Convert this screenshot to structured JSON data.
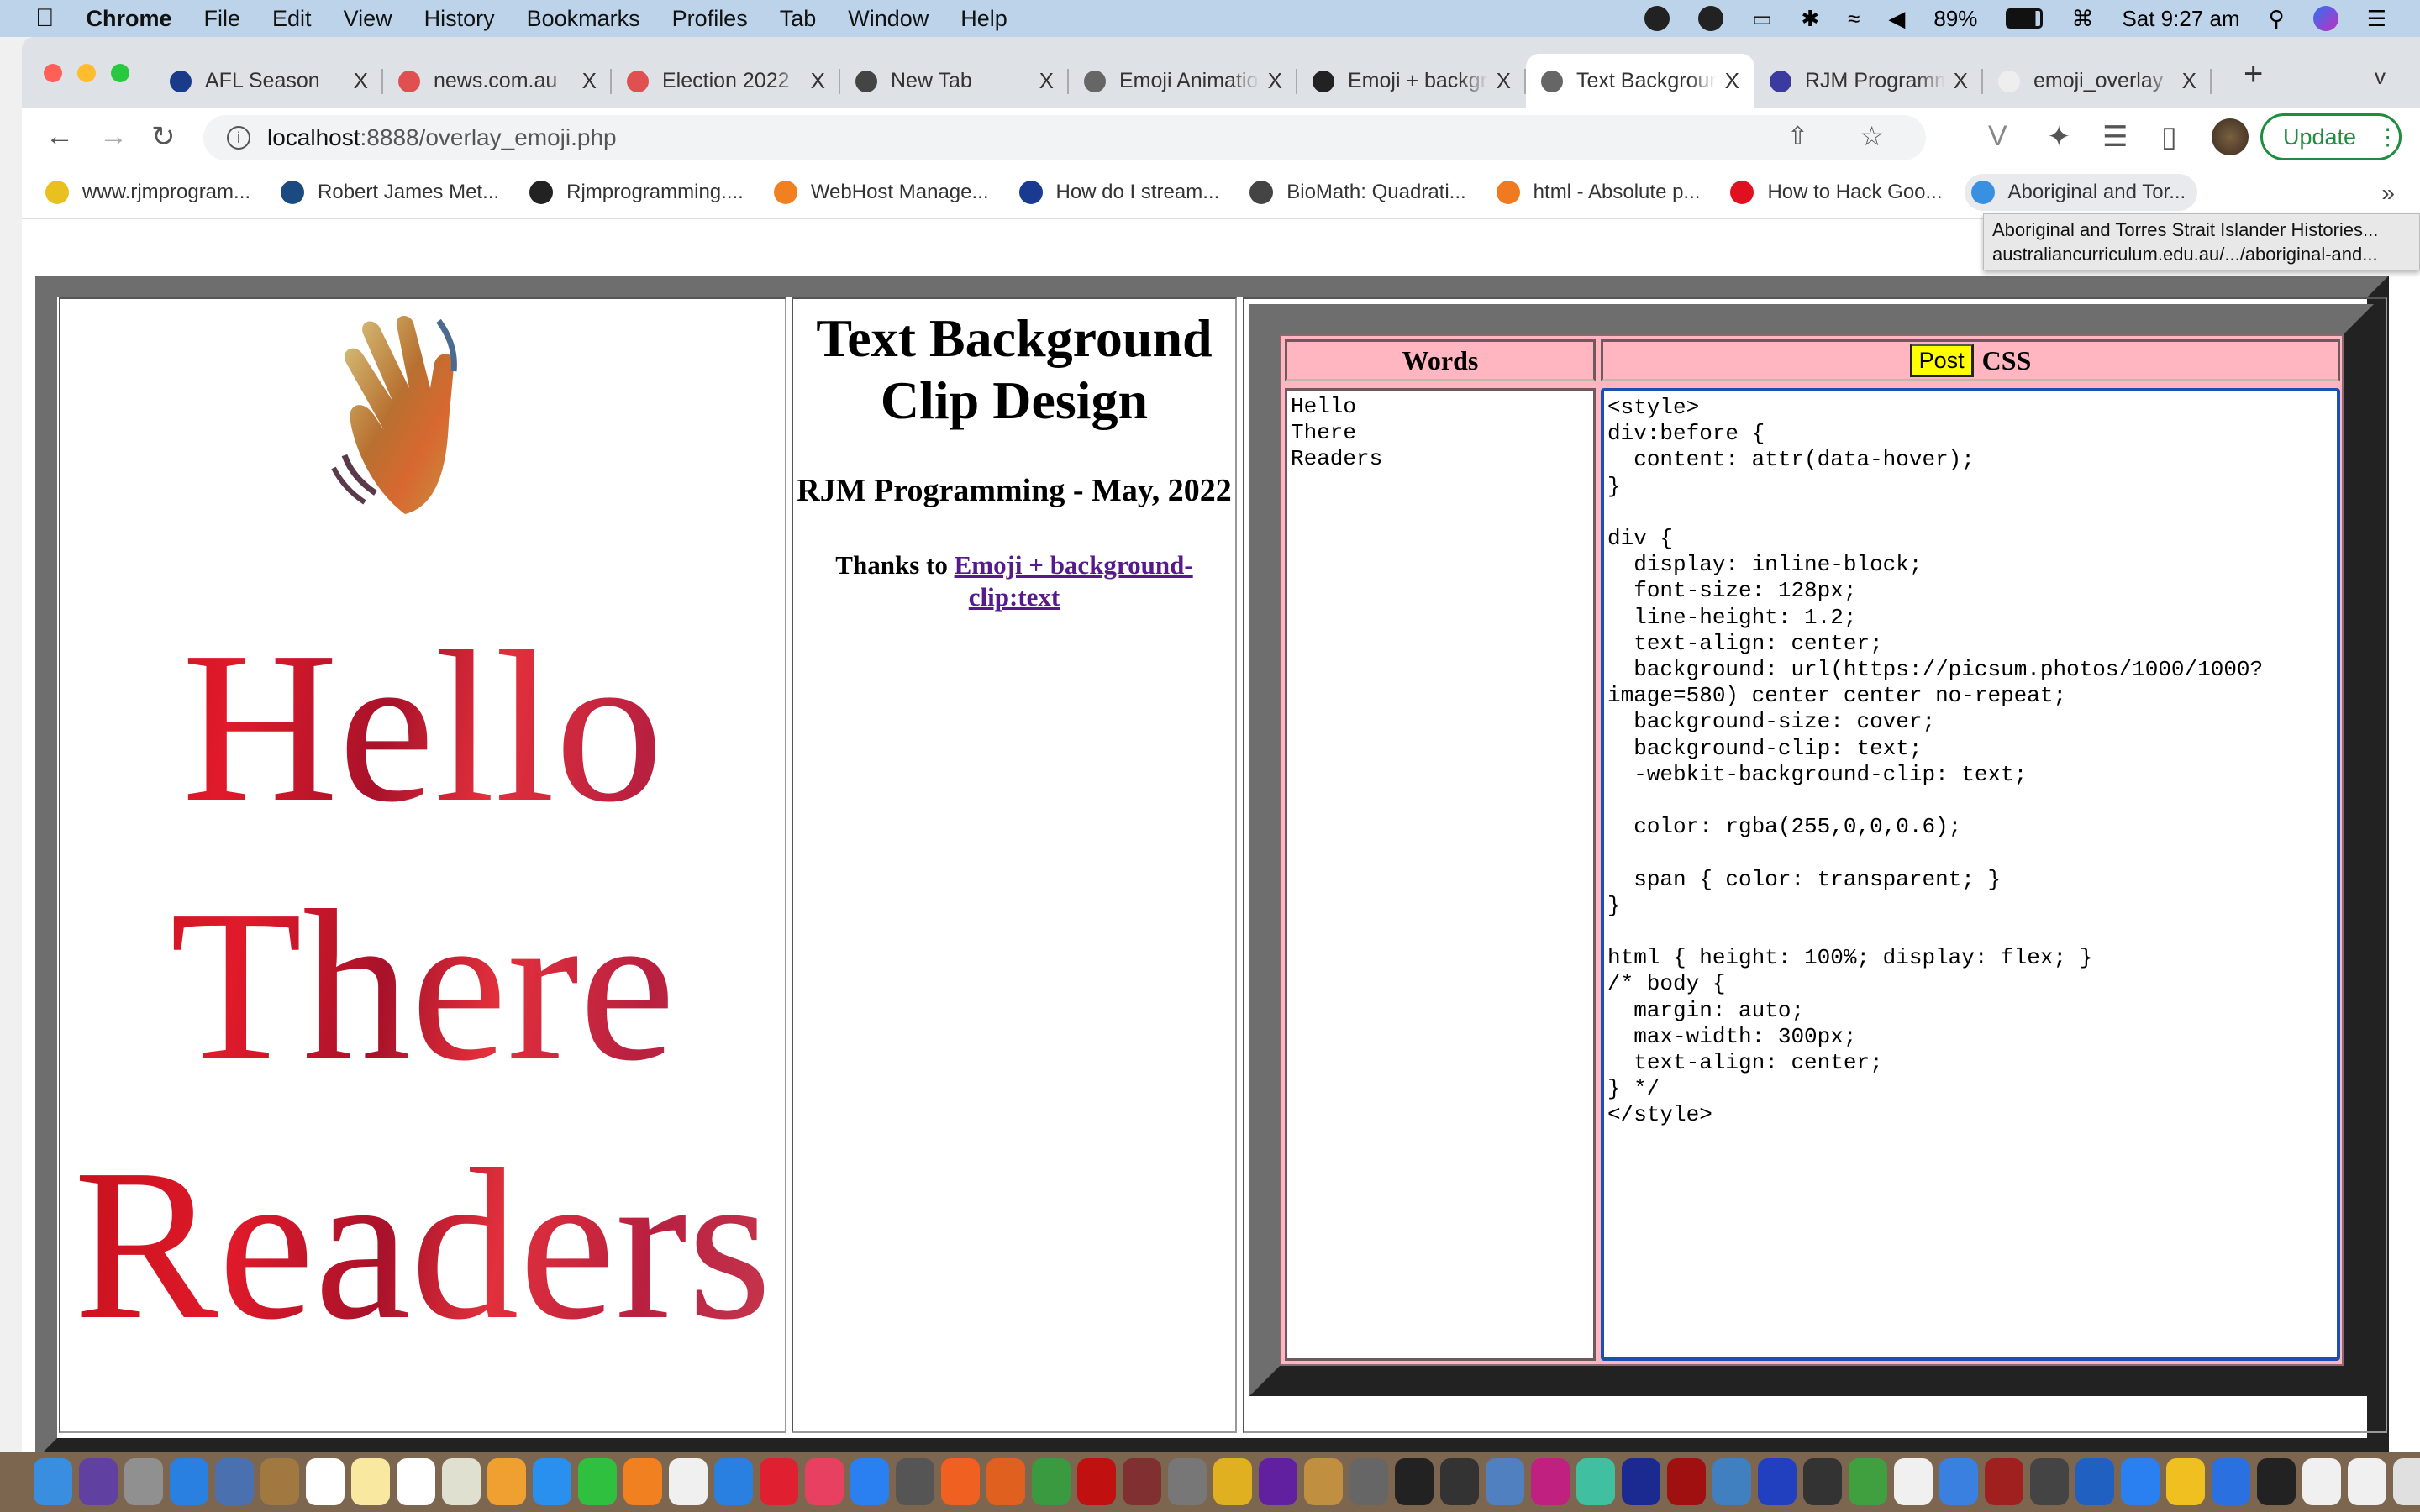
{
  "menubar": {
    "app": "Chrome",
    "items": [
      "File",
      "Edit",
      "View",
      "History",
      "Bookmarks",
      "Profiles",
      "Tab",
      "Window",
      "Help"
    ],
    "battery": "89%",
    "clock": "Sat 9:27 am"
  },
  "tabs": [
    {
      "title": "AFL Season",
      "color": "#1a3a8a"
    },
    {
      "title": "news.com.au",
      "color": "#e05050"
    },
    {
      "title": "Election 2022",
      "color": "#e05050"
    },
    {
      "title": "New Tab",
      "color": "#444444"
    },
    {
      "title": "Emoji Animations",
      "color": "#666666"
    },
    {
      "title": "Emoji + background",
      "color": "#222222"
    },
    {
      "title": "Text Background",
      "color": "#666666",
      "active": true
    },
    {
      "title": "RJM Programming",
      "color": "#3a3aa0"
    },
    {
      "title": "emoji_overlay",
      "color": "#eeeeee"
    }
  ],
  "tabstrip": {
    "new_tab": "+",
    "tab_menu": "v"
  },
  "toolbar": {
    "url_host": "localhost",
    "url_path": ":8888/overlay_emoji.php",
    "update_label": "Update"
  },
  "bookmarks": [
    {
      "label": "www.rjmprogram...",
      "color": "#e8c020"
    },
    {
      "label": "Robert James Met...",
      "color": "#1a4a80"
    },
    {
      "label": "Rjmprogramming....",
      "color": "#222222"
    },
    {
      "label": "WebHost Manage...",
      "color": "#f08020"
    },
    {
      "label": "How do I stream...",
      "color": "#1a3a90"
    },
    {
      "label": "BioMath: Quadrati...",
      "color": "#444444"
    },
    {
      "label": "html - Absolute p...",
      "color": "#f07a20"
    },
    {
      "label": "How to Hack Goo...",
      "color": "#e01020"
    },
    {
      "label": "Aboriginal and Tor...",
      "color": "#3a90e0"
    }
  ],
  "bookmarks_more": "»",
  "tooltip": {
    "title": "Aboriginal and Torres Strait Islander Histories...",
    "url": "australiancurriculum.edu.au/.../aboriginal-and..."
  },
  "page": {
    "words": [
      "Hello",
      "There",
      "Readers"
    ],
    "title": "Text Background Clip Design",
    "byline": "RJM Programming - May, 2022",
    "thanks_prefix": "Thanks to ",
    "thanks_link": "Emoji + background-clip:text",
    "words_header": "Words",
    "post_label": "Post",
    "css_header": "CSS",
    "words_text": "Hello\nThere\nReaders",
    "css_text": "<style>\ndiv:before {\n  content: attr(data-hover);\n}\n\ndiv {\n  display: inline-block;\n  font-size: 128px;\n  line-height: 1.2;\n  text-align: center;\n  background: url(https://picsum.photos/1000/1000?image=580) center center no-repeat;\n  background-size: cover;\n  background-clip: text;\n  -webkit-background-clip: text;\n\n  color: rgba(255,0,0,0.6);\n\n  span { color: transparent; }\n}\n\nhtml { height: 100%; display: flex; }\n/* body {\n  margin: auto;\n  max-width: 300px;\n  text-align: center;\n} */\n</style>",
    "colors": {
      "pink": "#ffb6c1",
      "post_button": "#ffff00",
      "link": "#551a8b",
      "frame": "#6e6e6e"
    }
  },
  "dock": {
    "colors": [
      "#3a8ee0",
      "#6040a0",
      "#909090",
      "#2a80e0",
      "#4a70b0",
      "#a07840",
      "#ffffff",
      "#f8e8a0",
      "#ffffff",
      "#e0e0d0",
      "#f0a030",
      "#2a90f0",
      "#30c040",
      "#f08020",
      "#f0f0f0",
      "#2a80e0",
      "#e02030",
      "#e84060",
      "#2a80f0",
      "#555555",
      "#f06020",
      "#e06020",
      "#3a9a40",
      "#c01010",
      "#803030",
      "#777777",
      "#e0b020",
      "#6020a0",
      "#c09040",
      "#666666",
      "#222222",
      "#333333",
      "#5080c0",
      "#c02080",
      "#40c0a0",
      "#1a2a90",
      "#a01010",
      "#4080c0",
      "#2040c0",
      "#333333",
      "#40a040",
      "#f0f0f0",
      "#3a80e0",
      "#a02020",
      "#444444",
      "#2060c0",
      "#2a80f0",
      "#f0c020",
      "#2a70e0",
      "#222222",
      "#f0f0f0",
      "#f0f0f0",
      "#e0e0e0",
      "#d0d0d0"
    ]
  }
}
